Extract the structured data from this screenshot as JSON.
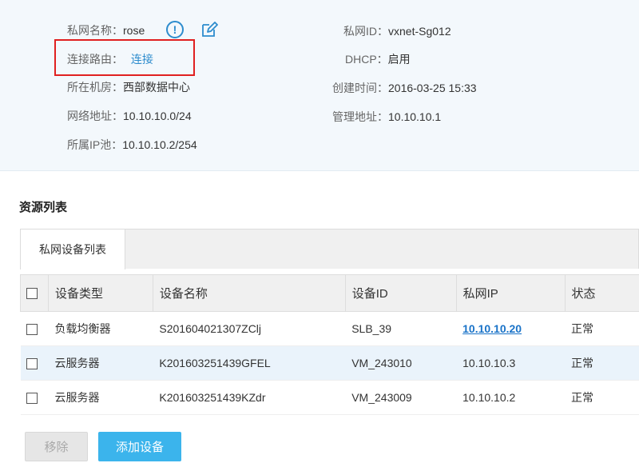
{
  "info": {
    "name_label": "私网名称：",
    "name_value": "rose",
    "route_label": "连接路由：",
    "route_value": "连接",
    "dc_label": "所在机房：",
    "dc_value": "西部数据中心",
    "net_label": "网络地址：",
    "net_value": "10.10.10.0/24",
    "pool_label": "所属IP池：",
    "pool_value": "10.10.10.2/254",
    "id_label": "私网ID：",
    "id_value": "vxnet-Sg012",
    "dhcp_label": "DHCP：",
    "dhcp_value": "启用",
    "created_label": "创建时间：",
    "created_value": "2016-03-25 15:33",
    "mgmt_label": "管理地址：",
    "mgmt_value": "10.10.10.1",
    "info_icon_glyph": "!",
    "info_icon": "info-icon",
    "edit_icon": "edit-icon",
    "highlight_color": "#e02020"
  },
  "resources": {
    "title": "资源列表",
    "tab": "私网设备列表",
    "columns": {
      "type": "设备类型",
      "name": "设备名称",
      "id": "设备ID",
      "ip": "私网IP",
      "status": "状态"
    },
    "rows": [
      {
        "type": "负载均衡器",
        "name": "S201604021307ZClj",
        "id": "SLB_39",
        "ip": "10.10.10.20",
        "status": "正常"
      },
      {
        "type": "云服务器",
        "name": "K201603251439GFEL",
        "id": "VM_243010",
        "ip": "10.10.10.3",
        "status": "正常"
      },
      {
        "type": "云服务器",
        "name": "K201603251439KZdr",
        "id": "VM_243009",
        "ip": "10.10.10.2",
        "status": "正常"
      }
    ]
  },
  "actions": {
    "remove_label": "移除",
    "add_label": "添加设备"
  },
  "colors": {
    "accent": "#2d8ccd",
    "primary_button": "#3bb4ec",
    "link": "#1a73c8",
    "selected_row": "#eaf3fb"
  }
}
